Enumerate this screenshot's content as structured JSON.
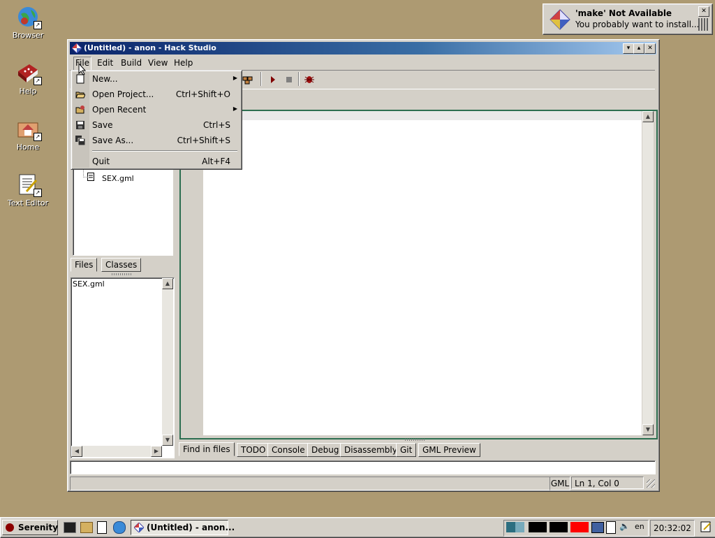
{
  "desktop": {
    "icons": [
      {
        "label": "Browser"
      },
      {
        "label": "Help"
      },
      {
        "label": "Home"
      },
      {
        "label": "Text Editor"
      }
    ]
  },
  "notification": {
    "title": "'make' Not Available",
    "body": "You probably want to install..."
  },
  "window": {
    "title": "(Untitled) - anon - Hack Studio",
    "menubar": [
      "File",
      "Edit",
      "Build",
      "View",
      "Help"
    ],
    "file_menu": [
      {
        "label": "New...",
        "shortcut": "",
        "submenu": true,
        "icon": "new-file-icon"
      },
      {
        "label": "Open Project...",
        "shortcut": "Ctrl+Shift+O",
        "submenu": false,
        "icon": "open-folder-icon"
      },
      {
        "label": "Open Recent",
        "shortcut": "",
        "submenu": true,
        "icon": "recent-folder-icon"
      },
      {
        "label": "Save",
        "shortcut": "Ctrl+S",
        "submenu": false,
        "icon": "save-icon"
      },
      {
        "label": "Save As...",
        "shortcut": "Ctrl+Shift+S",
        "submenu": false,
        "icon": "save-as-icon"
      },
      {
        "label": "Quit",
        "shortcut": "Alt+F4",
        "submenu": false,
        "icon": ""
      }
    ],
    "project_tree": {
      "file": "SEX.gml"
    },
    "left_tabs": [
      "Files",
      "Classes"
    ],
    "open_files": [
      "SEX.gml"
    ],
    "bottom_tabs": [
      "Find in files",
      "TODO",
      "Console",
      "Debug",
      "Disassembly",
      "Git",
      "GML Preview"
    ],
    "statusbar": {
      "language": "GML",
      "position": "Ln 1, Col 0"
    }
  },
  "taskbar": {
    "start_label": "Serenity",
    "task_label": "(Untitled) - anon...",
    "keyboard": "en",
    "clock": "20:32:02"
  },
  "colors": {
    "title_active": "#0a246a",
    "desktop": "#ad9a72",
    "graph_red": "#ff0000"
  }
}
